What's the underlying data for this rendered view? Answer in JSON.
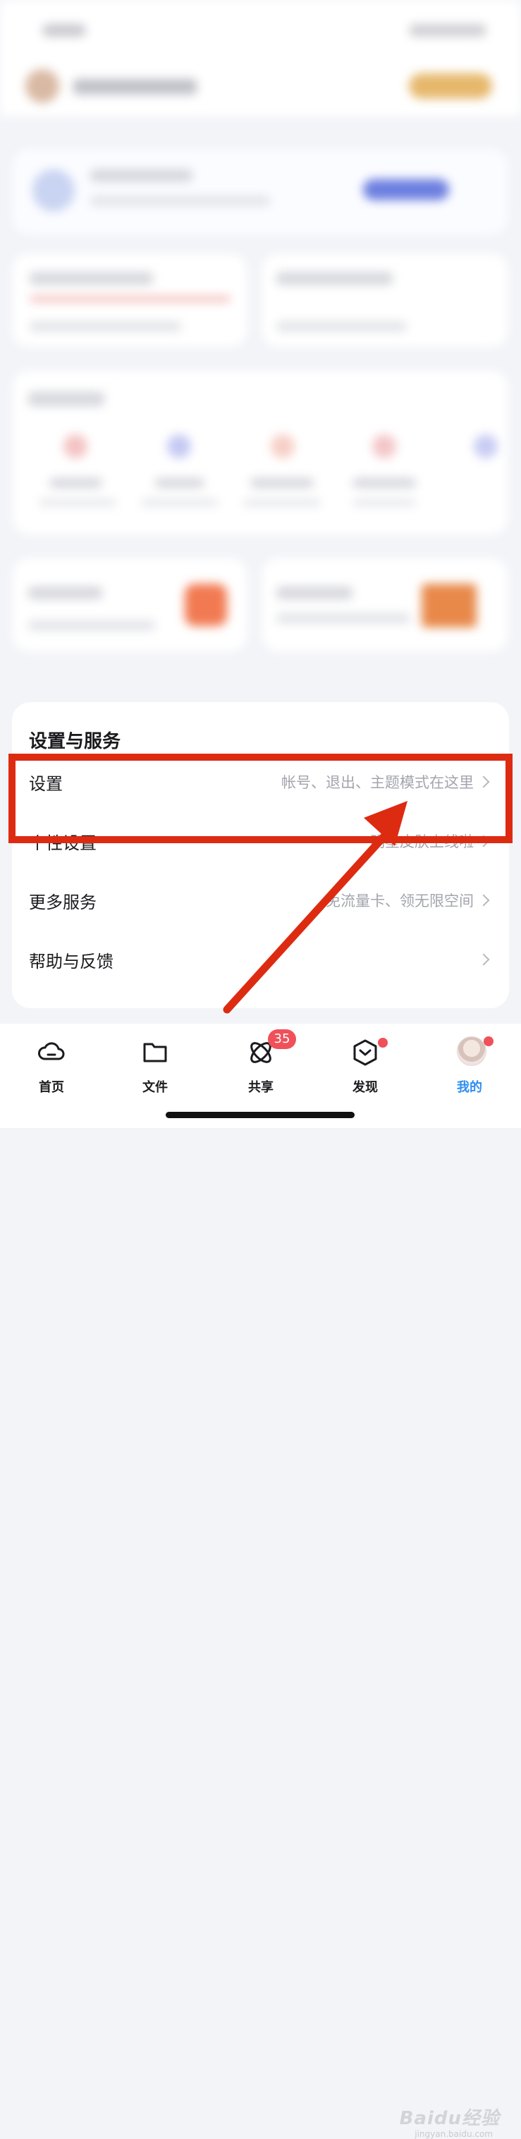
{
  "settings_panel": {
    "title": "设置与服务",
    "rows": [
      {
        "label": "设置",
        "hint": "帐号、退出、主题模式在这里"
      },
      {
        "label": "个性设置",
        "hint": "明星皮肤上线啦"
      },
      {
        "label": "更多服务",
        "hint": "免流量卡、领无限空间"
      },
      {
        "label": "帮助与反馈",
        "hint": ""
      }
    ]
  },
  "tabbar": {
    "tabs": [
      {
        "label": "首页",
        "icon": "cloud-icon"
      },
      {
        "label": "文件",
        "icon": "folder-icon"
      },
      {
        "label": "共享",
        "icon": "share-icon",
        "badge": "35"
      },
      {
        "label": "发现",
        "icon": "discover-icon",
        "dot": true
      },
      {
        "label": "我的",
        "icon": "avatar",
        "dot": true,
        "active": true
      }
    ]
  },
  "watermark": {
    "text": "Baidu经验",
    "sub": "jingyan.baidu.com"
  },
  "colors": {
    "accent": "#2f8df2",
    "annotation": "#dd2b12",
    "badge": "#f0505a"
  }
}
